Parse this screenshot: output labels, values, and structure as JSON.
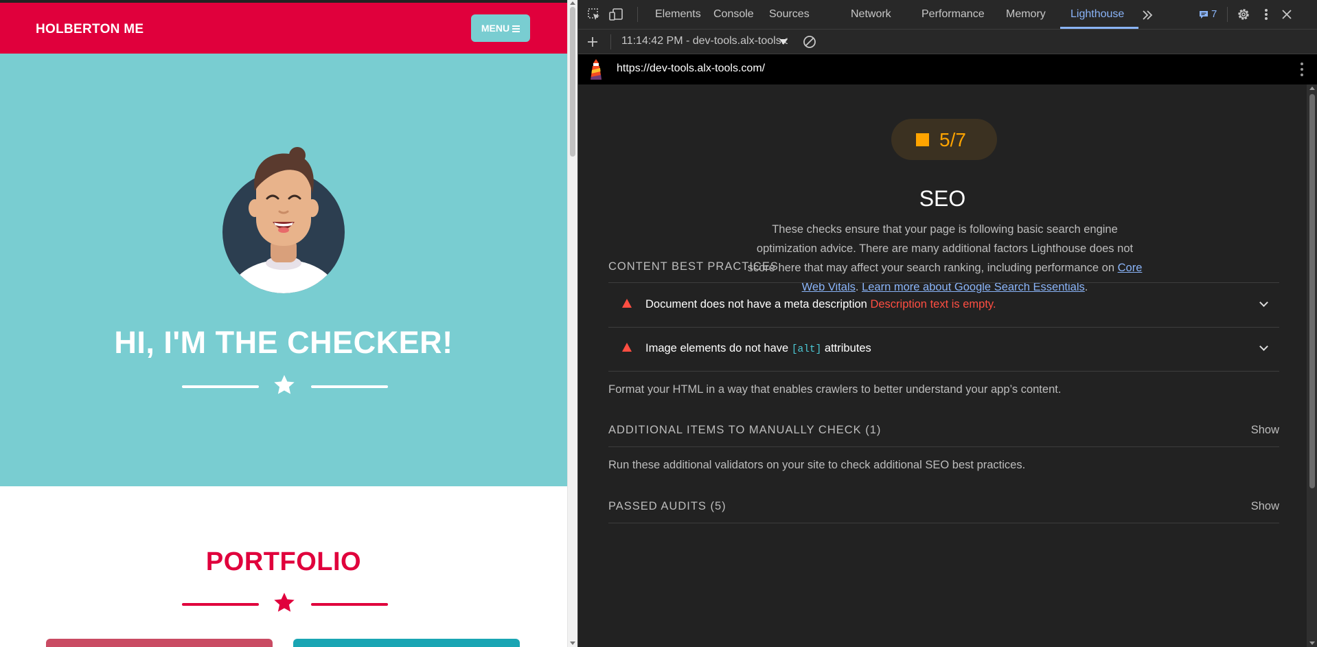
{
  "website": {
    "brand": "HOLBERTON ME",
    "menu_label": "MENU",
    "hero_title": "HI, I'M THE CHECKER!",
    "portfolio_title": "PORTFOLIO"
  },
  "devtools": {
    "tabs": [
      {
        "label": "Elements",
        "active": false
      },
      {
        "label": "Console",
        "active": false
      },
      {
        "label": "Sources",
        "active": false
      },
      {
        "label": "Network",
        "active": false
      },
      {
        "label": "Performance",
        "active": false
      },
      {
        "label": "Memory",
        "active": false
      },
      {
        "label": "Lighthouse",
        "active": true
      }
    ],
    "issues_count": "7",
    "report_selector": "11:14:42 PM - dev-tools.alx-tools.com",
    "url": "https://dev-tools.alx-tools.com/",
    "icons": {
      "inspect": "inspect-element-icon",
      "device": "device-toolbar-icon",
      "more_tabs": "more-tabs-icon",
      "issues": "issues-icon",
      "settings": "settings-gear-icon",
      "kebab": "kebab-menu-icon",
      "close": "close-icon",
      "add": "add-report-icon",
      "clear": "clear-report-icon",
      "lighthouse": "lighthouse-logo"
    }
  },
  "report": {
    "score": "5/7",
    "score_color": "#ffa400",
    "category_title": "SEO",
    "description": "These checks ensure that your page is following basic search engine optimization advice. There are many additional factors Lighthouse does not score here that may affect your search ranking, including performance on",
    "link1": "Core Web Vitals",
    "link2": "Learn more about Google Search Essentials",
    "groups": {
      "content": {
        "title": "CONTENT BEST PRACTICES",
        "audits": [
          {
            "title": "Document does not have a meta description",
            "warning": "Description text is empty."
          },
          {
            "title_before": "Image elements do not have",
            "code": "[alt]",
            "title_after": "attributes"
          }
        ],
        "description": "Format your HTML in a way that enables crawlers to better understand your app’s content."
      },
      "manual": {
        "title": "ADDITIONAL ITEMS TO MANUALLY CHECK (1)",
        "show_label": "Show",
        "description": "Run these additional validators on your site to check additional SEO best practices."
      },
      "passed": {
        "title": "PASSED AUDITS (5)",
        "show_label": "Show"
      }
    },
    "fail_color": "#ff4e42",
    "link_color": "#8ab4f8"
  }
}
